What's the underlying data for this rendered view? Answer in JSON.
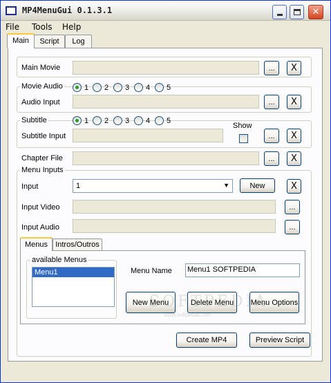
{
  "window": {
    "title": "MP4MenuGui 0.1.3.1"
  },
  "menubar": [
    "File",
    "Tools",
    "Help"
  ],
  "tabs": [
    "Main",
    "Script",
    "Log"
  ],
  "main_movie": {
    "label": "Main Movie",
    "browse": "...",
    "clear": "X"
  },
  "movie_audio": {
    "label": "Movie Audio",
    "options": [
      "1",
      "2",
      "3",
      "4",
      "5"
    ],
    "selected": "1",
    "input_label": "Audio Input",
    "browse": "...",
    "clear": "X"
  },
  "subtitle": {
    "label": "Subtitle",
    "options": [
      "1",
      "2",
      "3",
      "4",
      "5"
    ],
    "selected": "1",
    "input_label": "Subtitle Input",
    "show_label": "Show",
    "show_checked": false,
    "browse": "...",
    "clear": "X"
  },
  "chapter_file": {
    "label": "Chapter File",
    "browse": "...",
    "clear": "X"
  },
  "menu_inputs": {
    "title": "Menu Inputs",
    "input_label": "Input",
    "input_value": "1",
    "new_button": "New",
    "clear": "X",
    "video_label": "Input Video",
    "audio_label": "Input Audio",
    "browse": "..."
  },
  "menus_tabs": [
    "Menus",
    "Intros/Outros"
  ],
  "menus": {
    "available_title": "available Menus",
    "items": [
      "Menu1"
    ],
    "name_label": "Menu Name",
    "name_value": "Menu1 SOFTPEDIA",
    "new_menu": "New Menu",
    "delete_menu": "Delete Menu",
    "menu_options": "Menu Options"
  },
  "bottom": {
    "create": "Create MP4",
    "preview": "Preview Script"
  },
  "watermark": {
    "text": "SOFTPEDIA",
    "url": "www.softpedia.com"
  }
}
